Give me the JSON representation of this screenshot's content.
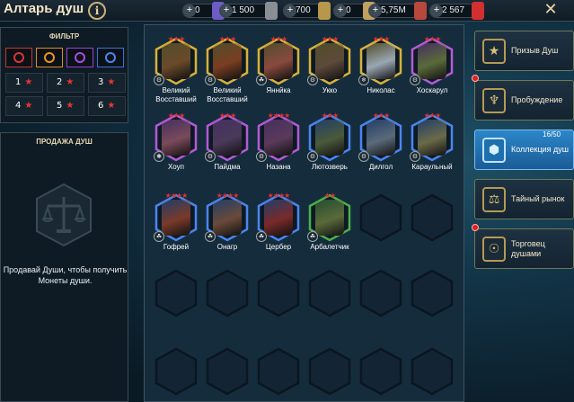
{
  "header": {
    "title": "Алтарь душ",
    "info_label": "i",
    "close_label": "✕"
  },
  "resources": [
    {
      "value": "0",
      "color": "#6d5cc5"
    },
    {
      "value": "1 500",
      "color": "#8a8f94"
    },
    {
      "value": "700",
      "color": "#b8964a"
    },
    {
      "value": "0",
      "color": "#c0a160"
    },
    {
      "value": "5,75M",
      "color": "#b7483b"
    },
    {
      "value": "2 567",
      "color": "#d23030"
    }
  ],
  "filter": {
    "title": "ФИЛЬТР",
    "types": [
      {
        "name": "red-soul-icon",
        "color": "#d33"
      },
      {
        "name": "orange-soul-icon",
        "color": "#e8951f"
      },
      {
        "name": "purple-soul-icon",
        "color": "#a84be0"
      },
      {
        "name": "blue-soul-icon",
        "color": "#4a86f0"
      }
    ],
    "ranks": [
      "1",
      "2",
      "3",
      "4",
      "5",
      "6"
    ]
  },
  "sell": {
    "title": "ПРОДАЖА ДУШ",
    "text": "Продавай Души, чтобы получить Монеты души."
  },
  "heroes": [
    {
      "name": "Великий Восставший",
      "stars": "★★★",
      "frame": "#d8b238",
      "face": "#6b4a2a"
    },
    {
      "name": "Великий Восставший",
      "stars": "★★★",
      "frame": "#d8b238",
      "face": "#7a3e22"
    },
    {
      "name": "Яннйка",
      "stars": "★★★",
      "frame": "#d8b238",
      "face": "#8a4a3e"
    },
    {
      "name": "Укко",
      "stars": "★★★",
      "frame": "#d8b238",
      "face": "#5d4a3a"
    },
    {
      "name": "Николас",
      "stars": "★★★",
      "frame": "#d8b238",
      "face": "#9aa6b2"
    },
    {
      "name": "Хоскарул",
      "stars": "★★★",
      "frame": "#b45ad6",
      "face": "#5a6a3a"
    },
    {
      "name": "Хоуп",
      "stars": "★★★",
      "frame": "#b45ad6",
      "face": "#7a4a5a"
    },
    {
      "name": "Пайдма",
      "stars": "★★★",
      "frame": "#b45ad6",
      "face": "#4a3a5a"
    },
    {
      "name": "Назана",
      "stars": "★★★★",
      "frame": "#b45ad6",
      "face": "#5a3a5a"
    },
    {
      "name": "Лютозверь",
      "stars": "★★★",
      "frame": "#4a86f0",
      "face": "#4a5a3a"
    },
    {
      "name": "Дилгол",
      "stars": "★★★",
      "frame": "#4a86f0",
      "face": "#5a6a7a"
    },
    {
      "name": "Караульный",
      "stars": "★★★",
      "frame": "#4a86f0",
      "face": "#6a6a4a"
    },
    {
      "name": "Гофрей",
      "stars": "★★★★",
      "frame": "#4a86f0",
      "face": "#7a3a2a"
    },
    {
      "name": "Онагр",
      "stars": "★★★★",
      "frame": "#4a86f0",
      "face": "#6a4a3a"
    },
    {
      "name": "Цербер",
      "stars": "★★★★",
      "frame": "#4a86f0",
      "face": "#7a2a2a"
    },
    {
      "name": "Арбалетчик",
      "stars": "★★",
      "frame": "#4cb04c",
      "face": "#5a6a3a"
    }
  ],
  "menu": [
    {
      "label": "Призыв Душ",
      "icon": "star-icon",
      "glyph": "★"
    },
    {
      "label": "Пробуждение",
      "icon": "helmet-icon",
      "glyph": "♆"
    },
    {
      "label": "Коллекция душ",
      "icon": "soul-collection-icon",
      "glyph": "⬢"
    },
    {
      "label": "Тайный рынок",
      "icon": "market-icon",
      "glyph": "⚖"
    },
    {
      "label": "Торговец душами",
      "icon": "merchant-icon",
      "glyph": "☉"
    }
  ],
  "collection_counter": "16/50"
}
